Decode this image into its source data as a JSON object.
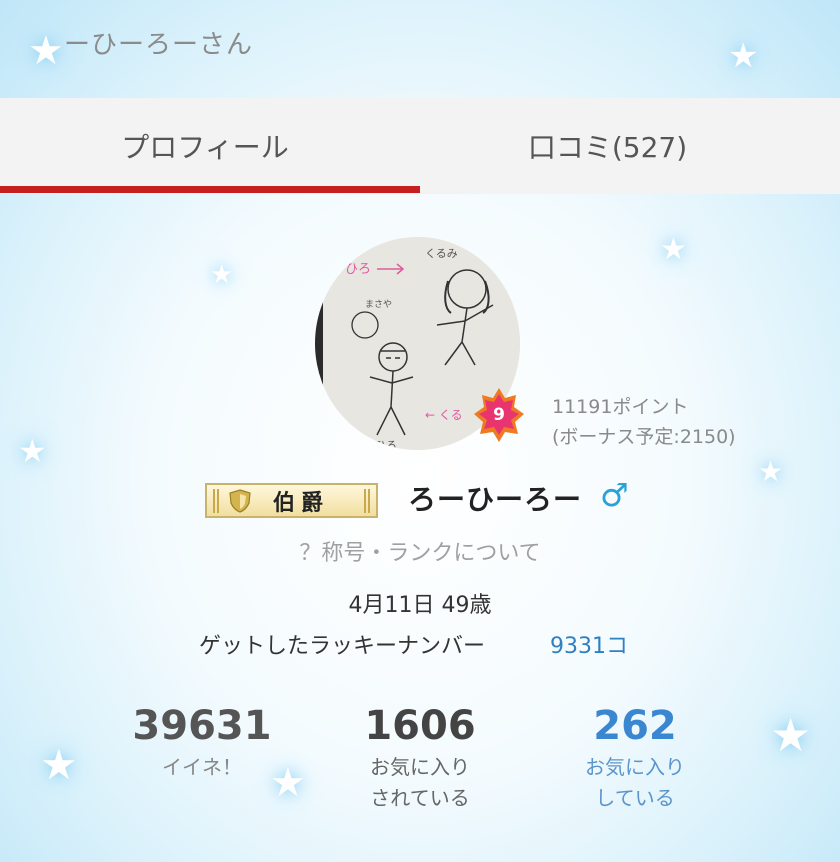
{
  "header": {
    "title": "ーひーろーさん"
  },
  "tabs": [
    {
      "label": "プロフィール",
      "active": true
    },
    {
      "label": "口コミ(527)",
      "active": false
    }
  ],
  "profile": {
    "rank_level": "9",
    "points": "11191ポイント",
    "bonus": "(ボーナス予定:2150)",
    "title_badge": "伯爵",
    "username": "ろーひーろー",
    "gender_symbol": "♂",
    "rank_info_link": "？称号・ランクについて",
    "birthday_age": "4月11日 49歳",
    "lucky_label": "ゲットしたラッキーナンバー",
    "lucky_count": "9331コ"
  },
  "stats": {
    "likes": {
      "value": "39631",
      "label": "イイネ！"
    },
    "favorited_by": {
      "value": "1606",
      "label_line1": "お気に入り",
      "label_line2": "されている"
    },
    "favoriting": {
      "value": "262",
      "label_line1": "お気に入り",
      "label_line2": "している"
    }
  },
  "colors": {
    "accent": "#c51f1f",
    "link": "#2f7fc5",
    "gender": "#2aa1d8",
    "badge_orange": "#f07a22"
  },
  "icons": [
    "star-sparkle-icon",
    "rank-badge-icon",
    "shield-icon",
    "male-symbol-icon"
  ]
}
